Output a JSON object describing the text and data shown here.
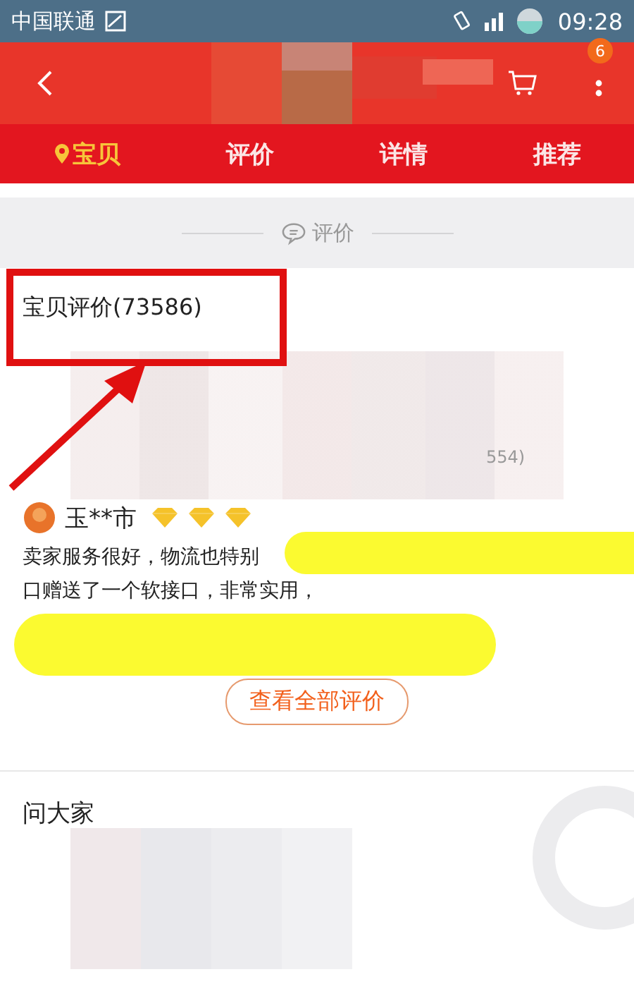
{
  "status_bar": {
    "carrier": "中国联通",
    "time": "09:28"
  },
  "header": {
    "menu_badge": "6"
  },
  "tabs": [
    {
      "label": "宝贝",
      "selected": true
    },
    {
      "label": "评价",
      "selected": false
    },
    {
      "label": "详情",
      "selected": false
    },
    {
      "label": "推荐",
      "selected": false
    }
  ],
  "section_divider": {
    "label": "评价"
  },
  "reviews": {
    "title": "宝贝评价(73586)",
    "tag_count": "554)",
    "review": {
      "user": "玉**市",
      "level_icons": [
        {
          "kind": "diamond"
        },
        {
          "kind": "diamond"
        },
        {
          "kind": "diamond"
        }
      ],
      "lines": [
        "卖家服务很好，物流也特别",
        "口赠送了一个软接口，非常实用，"
      ]
    },
    "button": "查看全部评价"
  },
  "questions": {
    "title": "问大家"
  }
}
